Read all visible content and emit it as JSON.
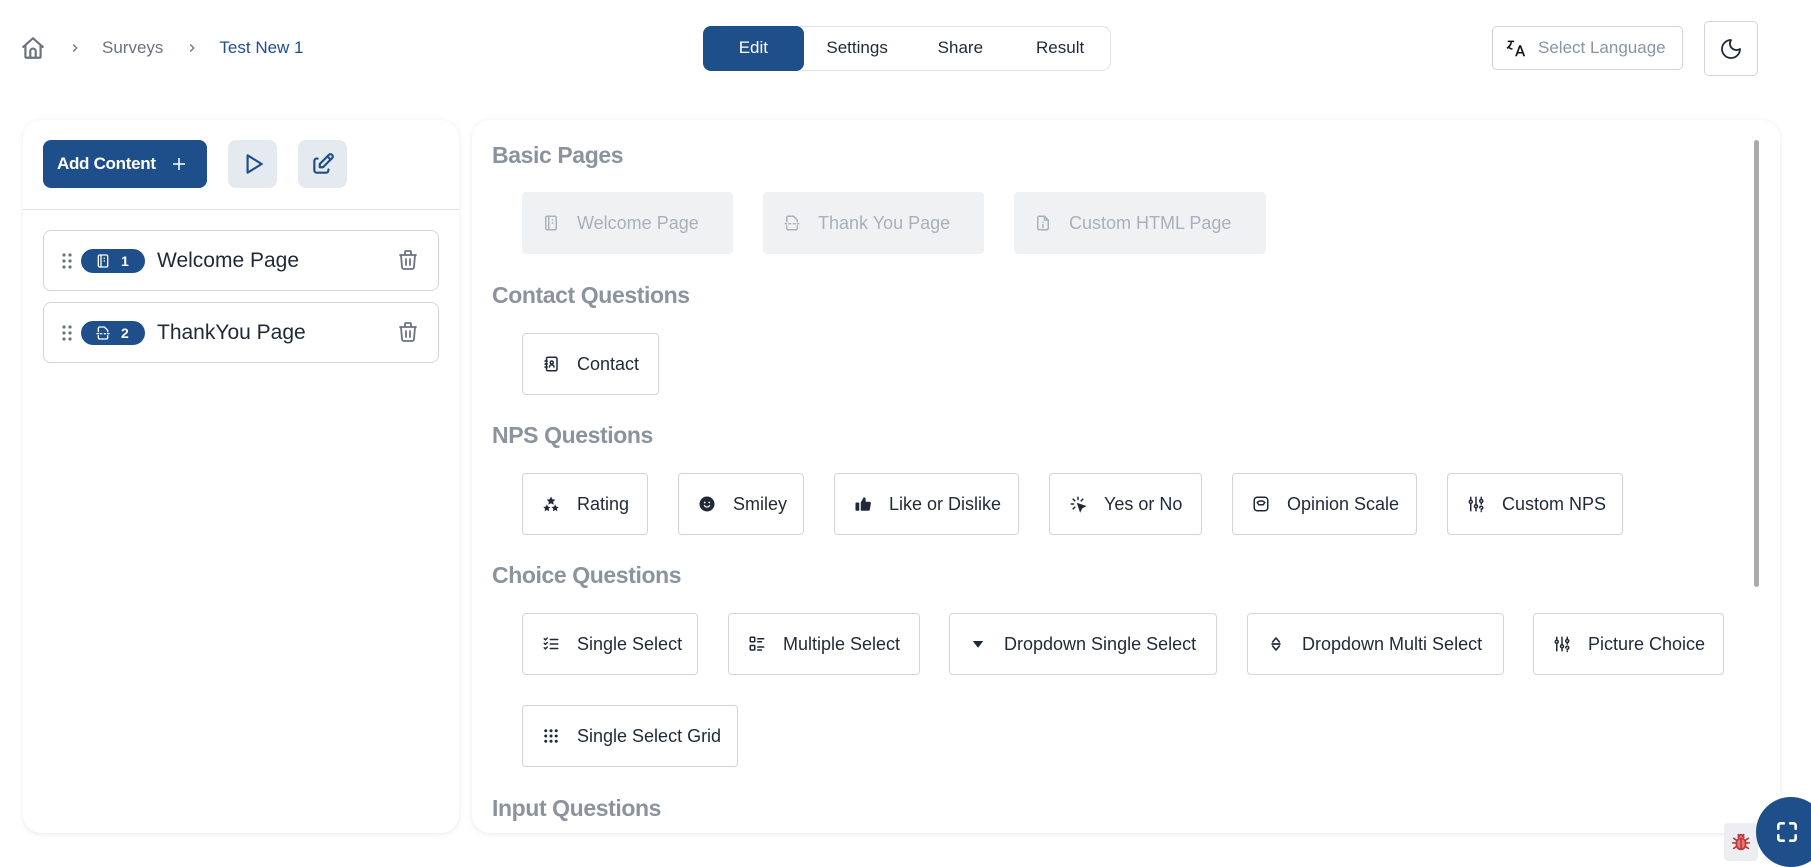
{
  "breadcrumb": {
    "home_icon": "home-icon",
    "items": [
      "Surveys",
      "Test New 1"
    ]
  },
  "tabs": [
    {
      "label": "Edit",
      "active": true
    },
    {
      "label": "Settings",
      "active": false
    },
    {
      "label": "Share",
      "active": false
    },
    {
      "label": "Result",
      "active": false
    }
  ],
  "language": {
    "placeholder": "Select Language",
    "icon": "translate-icon"
  },
  "theme_toggle": {
    "icon": "moon-icon"
  },
  "sidebar": {
    "add_content_label": "Add Content",
    "preview_icon": "play-icon",
    "edit_icon": "edit-icon",
    "items": [
      {
        "number": "1",
        "label": "Welcome Page",
        "icon": "notebook-icon"
      },
      {
        "number": "2",
        "label": "ThankYou Page",
        "icon": "file-smile-icon"
      }
    ]
  },
  "content": {
    "sections": [
      {
        "title": "Basic Pages",
        "items": [
          {
            "label": "Welcome Page",
            "icon": "notebook-icon",
            "disabled": true
          },
          {
            "label": "Thank You Page",
            "icon": "file-smile-icon",
            "disabled": true
          },
          {
            "label": "Custom HTML Page",
            "icon": "file-info-icon",
            "disabled": true
          }
        ]
      },
      {
        "title": "Contact Questions",
        "items": [
          {
            "label": "Contact",
            "icon": "address-book-icon"
          }
        ]
      },
      {
        "title": "NPS Questions",
        "items": [
          {
            "label": "Rating",
            "icon": "stars-icon"
          },
          {
            "label": "Smiley",
            "icon": "smiley-icon"
          },
          {
            "label": "Like or Dislike",
            "icon": "thumbs-up-icon"
          },
          {
            "label": "Yes or No",
            "icon": "click-icon"
          },
          {
            "label": "Opinion Scale",
            "icon": "gauge-icon"
          },
          {
            "label": "Custom NPS",
            "icon": "sliders-icon"
          }
        ]
      },
      {
        "title": "Choice Questions",
        "items": [
          {
            "label": "Single Select",
            "icon": "checklist-icon"
          },
          {
            "label": "Multiple Select",
            "icon": "list-details-icon"
          },
          {
            "label": "Dropdown Single Select",
            "icon": "caret-down-icon"
          },
          {
            "label": "Dropdown Multi Select",
            "icon": "selector-icon"
          },
          {
            "label": "Picture Choice",
            "icon": "sliders-icon"
          },
          {
            "label": "Single Select Grid",
            "icon": "grid-dots-icon"
          }
        ]
      },
      {
        "title": "Input Questions",
        "items": []
      }
    ]
  },
  "floating": {
    "bug_icon": "bug-icon",
    "fullscreen_icon": "fullscreen-icon"
  },
  "colors": {
    "primary": "#1e4f8a",
    "muted": "#8a939e",
    "disabled_bg": "#f0f1f3"
  }
}
